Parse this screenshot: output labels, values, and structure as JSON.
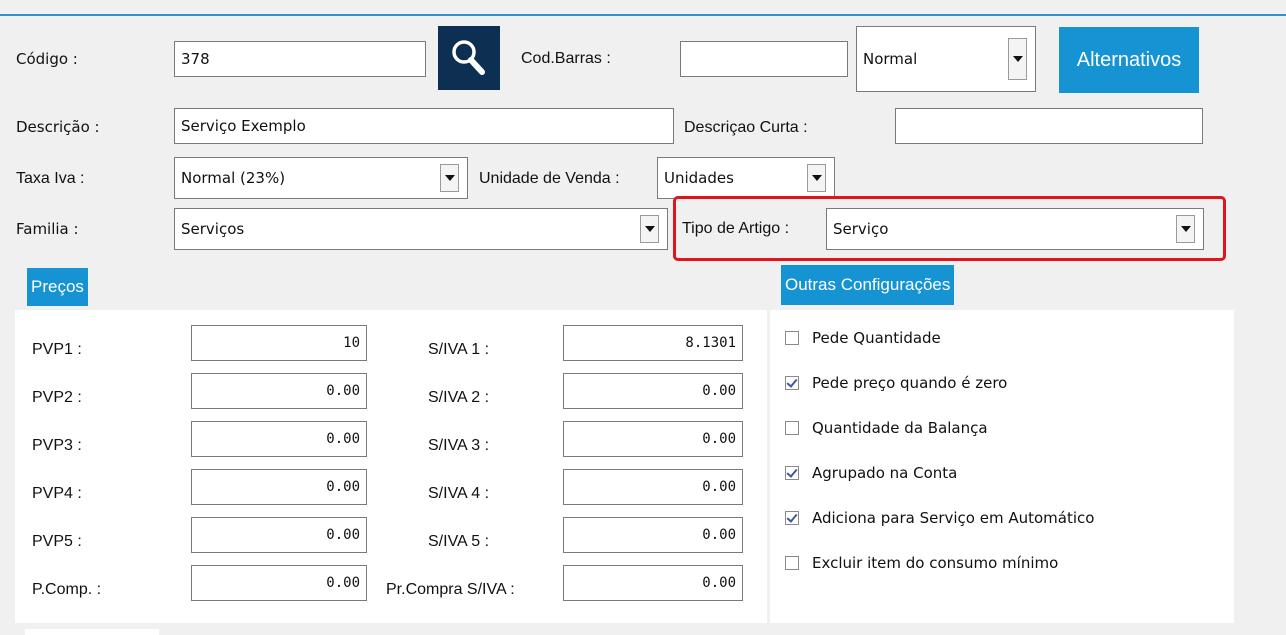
{
  "header": {
    "codigo_label": "Código :",
    "codigo_value": "378",
    "codbarras_label": "Cod.Barras :",
    "codbarras_value": "",
    "barcode_type": "Normal",
    "alternativos_button": "Alternativos"
  },
  "descricao": {
    "label": "Descrição :",
    "value": "Serviço Exemplo",
    "curta_label": "Descriçao Curta :",
    "curta_value": ""
  },
  "taxa": {
    "label": "Taxa Iva :",
    "value": "Normal (23%)",
    "unidade_label": "Unidade de Venda :",
    "unidade_value": "Unidades"
  },
  "familia": {
    "label": "Familia :",
    "value": "Serviços",
    "tipo_label": "Tipo de Artigo :",
    "tipo_value": "Serviço"
  },
  "precos": {
    "tab_label": "Preços",
    "rows": [
      {
        "pvp_label": "PVP1 :",
        "pvp_value": "10",
        "siva_label": "S/IVA 1 :",
        "siva_value": "8.1301"
      },
      {
        "pvp_label": "PVP2 :",
        "pvp_value": "0.00",
        "siva_label": "S/IVA 2 :",
        "siva_value": "0.00"
      },
      {
        "pvp_label": "PVP3 :",
        "pvp_value": "0.00",
        "siva_label": "S/IVA 3 :",
        "siva_value": "0.00"
      },
      {
        "pvp_label": "PVP4 :",
        "pvp_value": "0.00",
        "siva_label": "S/IVA 4 :",
        "siva_value": "0.00"
      },
      {
        "pvp_label": "PVP5 :",
        "pvp_value": "0.00",
        "siva_label": "S/IVA 5 :",
        "siva_value": "0.00"
      },
      {
        "pvp_label": "P.Comp. :",
        "pvp_value": "0.00",
        "siva_label": "Pr.Compra S/IVA :",
        "siva_value": "0.00"
      }
    ]
  },
  "outras": {
    "tab_label": "Outras Configurações",
    "options": [
      {
        "label": "Pede Quantidade",
        "checked": false
      },
      {
        "label": "Pede preço quando é zero",
        "checked": true
      },
      {
        "label": "Quantidade da Balança",
        "checked": false
      },
      {
        "label": "Agrupado na Conta",
        "checked": true
      },
      {
        "label": "Adiciona para Serviço em Automático",
        "checked": true
      },
      {
        "label": "Excluir item do consumo mínimo",
        "checked": false
      }
    ]
  },
  "colors": {
    "accent": "#1593d3",
    "search_button": "#0d2f52",
    "highlight": "#e0141e"
  },
  "icons": {
    "search": "magnifier-icon",
    "dropdown": "chevron-down-icon"
  }
}
